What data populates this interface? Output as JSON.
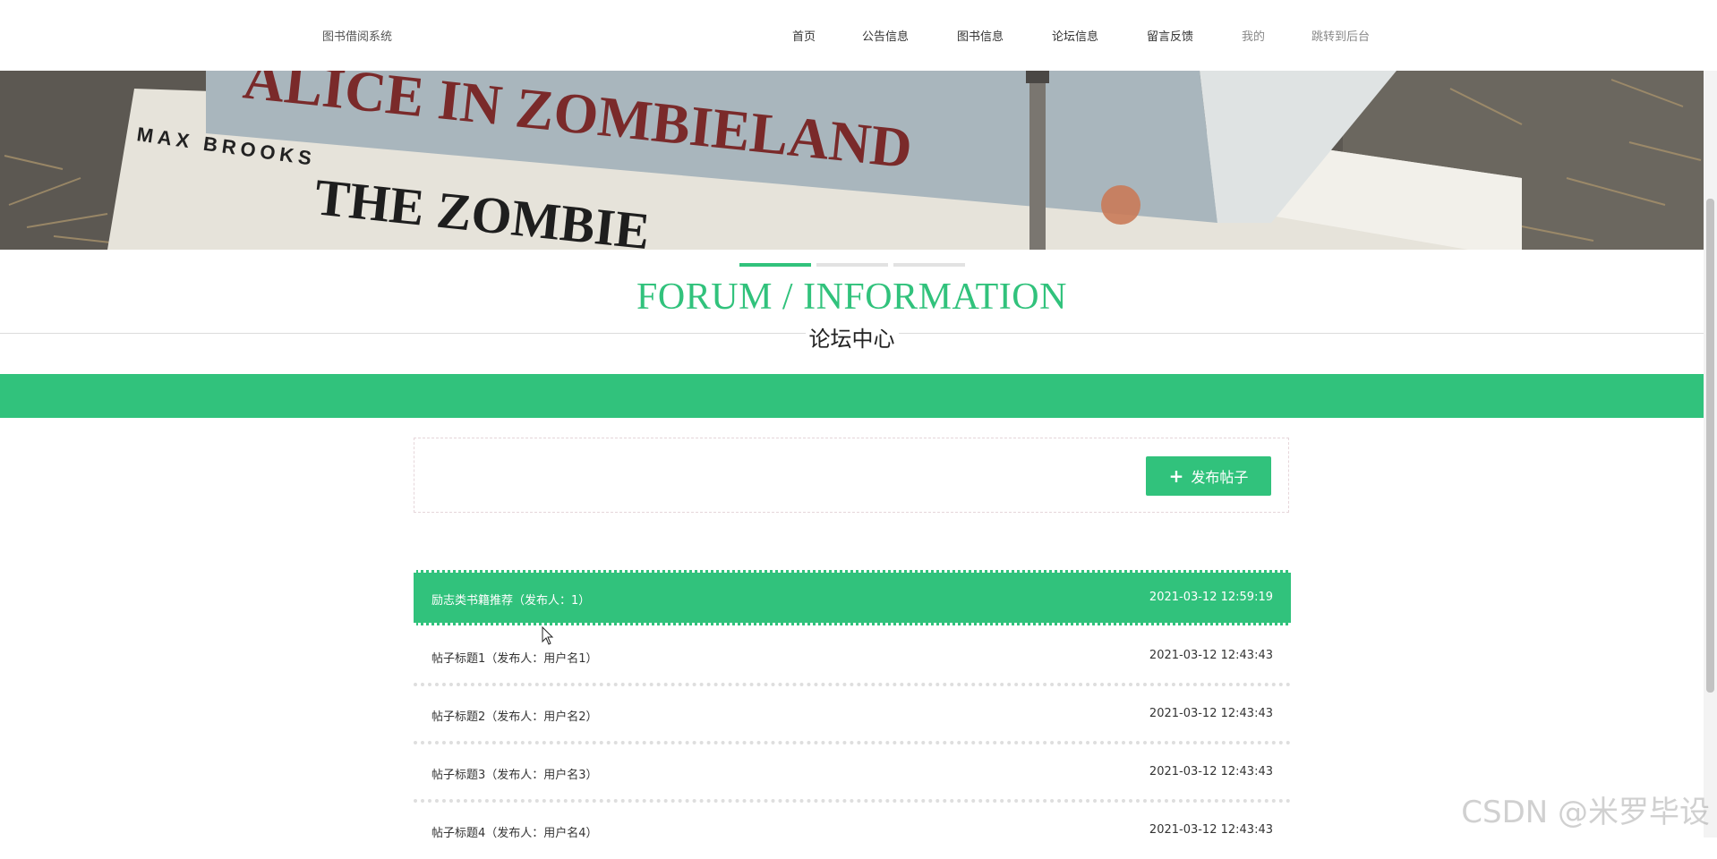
{
  "header": {
    "brand": "图书借阅系统",
    "nav": [
      {
        "label": "首页",
        "muted": false
      },
      {
        "label": "公告信息",
        "muted": false
      },
      {
        "label": "图书信息",
        "muted": false
      },
      {
        "label": "论坛信息",
        "muted": false
      },
      {
        "label": "留言反馈",
        "muted": false
      },
      {
        "label": "我的",
        "muted": true
      },
      {
        "label": "跳转到后台",
        "muted": true
      }
    ]
  },
  "banner": {
    "book_title": "ALICE IN ZOMBIELAND",
    "author": "MAX BROOKS",
    "second_book": "THE ZOMBIE"
  },
  "carousel": {
    "count": 3,
    "active_index": 0
  },
  "section": {
    "title_en": "FORUM / INFORMATION",
    "title_cn": "论坛中心"
  },
  "actions": {
    "publish_label": "发布帖子"
  },
  "posts": [
    {
      "title": "励志类书籍推荐（发布人：1）",
      "time": "2021-03-12 12:59:19",
      "active": true
    },
    {
      "title": "帖子标题1（发布人：用户名1）",
      "time": "2021-03-12 12:43:43",
      "active": false
    },
    {
      "title": "帖子标题2（发布人：用户名2）",
      "time": "2021-03-12 12:43:43",
      "active": false
    },
    {
      "title": "帖子标题3（发布人：用户名3）",
      "time": "2021-03-12 12:43:43",
      "active": false
    },
    {
      "title": "帖子标题4（发布人：用户名4）",
      "time": "2021-03-12 12:43:43",
      "active": false
    }
  ],
  "watermark": "CSDN @米罗毕设",
  "colors": {
    "accent": "#31c27c"
  }
}
